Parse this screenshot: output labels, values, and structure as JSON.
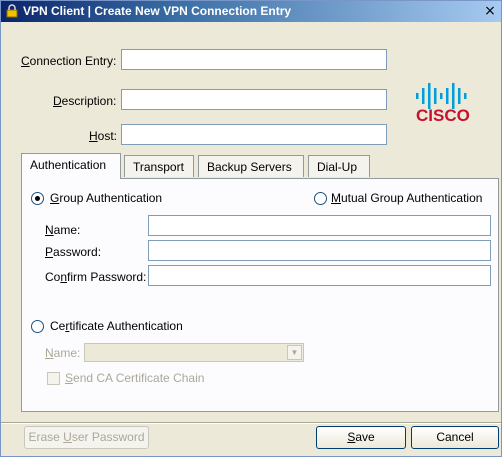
{
  "window": {
    "title": "VPN Client  |  Create New VPN Connection Entry",
    "close_label": "×"
  },
  "form": {
    "connection_entry": {
      "label_pre": "C",
      "label_rest": "onnection Entry:",
      "value": ""
    },
    "description": {
      "label_pre": "D",
      "label_rest": "escription:",
      "value": ""
    },
    "host": {
      "label_pre": "H",
      "label_rest": "ost:",
      "value": ""
    }
  },
  "logo": {
    "text": "CISCO"
  },
  "tabs": [
    {
      "label": "Authentication"
    },
    {
      "label": "Transport"
    },
    {
      "label": "Backup Servers"
    },
    {
      "label": "Dial-Up"
    }
  ],
  "auth": {
    "group_auth": {
      "label_pre": "G",
      "label_rest": "roup Authentication",
      "selected": true
    },
    "mutual_auth": {
      "label_pre": "M",
      "label_rest": "utual Group Authentication",
      "selected": false
    },
    "name": {
      "label_pre": "N",
      "label_rest": "ame:"
    },
    "password": {
      "label_pre": "P",
      "label_rest": "assword:"
    },
    "confirm_password": {
      "label_a": "Co",
      "label_u": "n",
      "label_rest": "firm Password:"
    },
    "cert_auth": {
      "label_a": "Ce",
      "label_u": "r",
      "label_rest": "tificate Authentication",
      "selected": false
    },
    "cert_name": {
      "label_pre": "N",
      "label_rest": "ame:"
    },
    "send_ca": {
      "label_pre": "S",
      "label_rest": "end CA Certificate Chain",
      "checked": false
    }
  },
  "buttons": {
    "erase": {
      "label_a": "Erase ",
      "label_u": "U",
      "label_rest": "ser Password"
    },
    "save": {
      "label_u": "S",
      "label_rest": "ave"
    },
    "cancel": {
      "label": "Cancel"
    }
  },
  "colors": {
    "title_start": "#0a246a",
    "cisco_blue": "#009edb",
    "cisco_text": "#c8102e"
  }
}
